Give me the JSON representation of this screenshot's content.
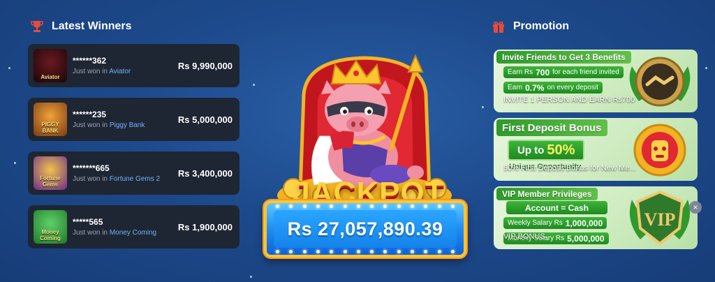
{
  "winners_section": {
    "title": "Latest Winners",
    "icon": "trophy-icon",
    "items": [
      {
        "user": "******362",
        "prefix": "Just won in",
        "game": "Aviator",
        "amount": "Rs 9,990,000",
        "thumb_label": "Aviator",
        "thumb_color": "#2a0e12"
      },
      {
        "user": "******235",
        "prefix": "Just won in",
        "game": "Piggy Bank",
        "amount": "Rs 5,000,000",
        "thumb_label": "PIGGY BANK",
        "thumb_color": "#7a3b12"
      },
      {
        "user": "*******665",
        "prefix": "Just won in",
        "game": "Fortune Gems 2",
        "amount": "Rs 3,400,000",
        "thumb_label": "Fortune Gems",
        "thumb_color": "#6a2d8a"
      },
      {
        "user": "*****565",
        "prefix": "Just won in",
        "game": "Money Coming",
        "amount": "Rs 1,900,000",
        "thumb_label": "Money Coming",
        "thumb_color": "#1f7a2a"
      }
    ]
  },
  "jackpot": {
    "title": "JACKPOT",
    "amount": "Rs 27,057,890.39"
  },
  "promotion_section": {
    "title": "Promotion",
    "icon": "gift-icon",
    "cards": [
      {
        "heading": "Invite Friends to Get 3 Benefits",
        "line1_prefix": "Earn Rs",
        "line1_value": "700",
        "line1_suffix": "for each friend invited",
        "line2_prefix": "Earn",
        "line2_value": "0.7%",
        "line2_suffix": "on every deposit",
        "overlay": "INVITE 1 PERSON AND EARN Rs700",
        "medal_icon": "handshake-medal-icon"
      },
      {
        "heading": "First Deposit Bonus",
        "pill_prefix": "Up to",
        "pill_value": "50%",
        "sub": "Unique Opportunity",
        "overlay": "50% First Deposit Bonus for New Me...",
        "medal_icon": "golden-mask-icon"
      },
      {
        "heading": "VIP Member Privileges",
        "line1": "Account = Cash",
        "line2_prefix": "Weekly Salary Rs",
        "line2_value": "1,000,000",
        "line3_prefix": "Monthly Salary Rs",
        "line3_value": "5,000,000",
        "overlay": "VIP BONUS",
        "medal_icon": "vip-shield-icon"
      }
    ]
  }
}
